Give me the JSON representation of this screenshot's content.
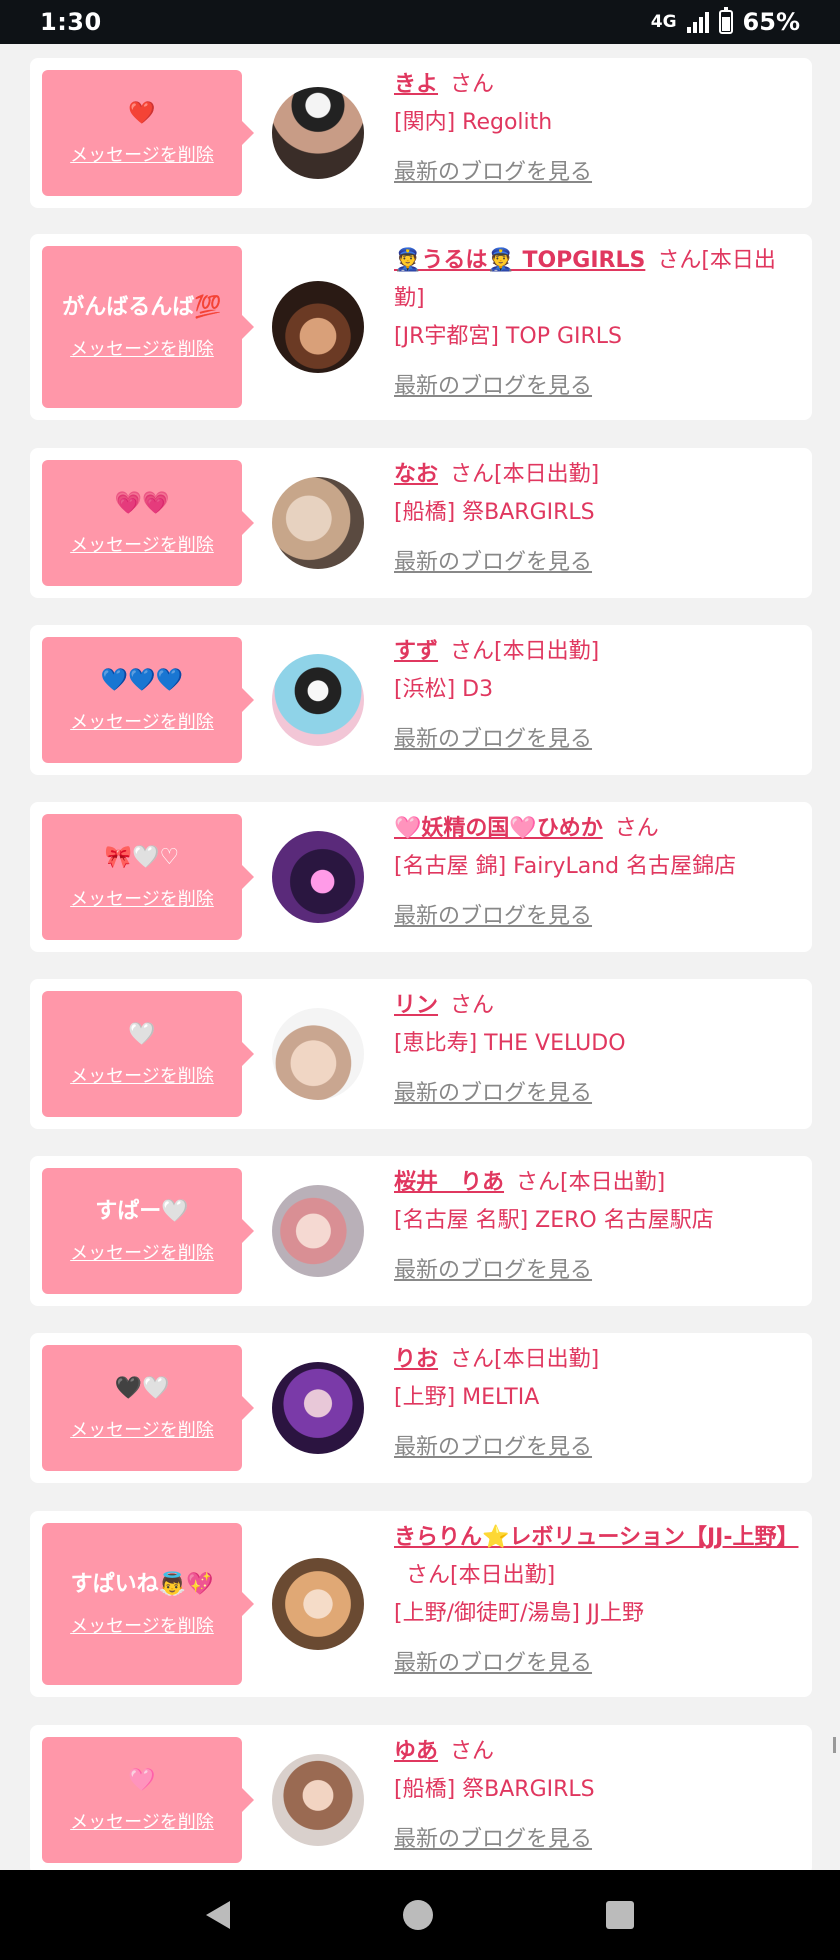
{
  "status_bar": {
    "time": "1:30",
    "network": "4G",
    "battery": "65%"
  },
  "delete_label": "メッセージを削除",
  "blog_label": "最新のブログを見る",
  "san_label": "さん",
  "entries": [
    {
      "message": "❤️",
      "name": "きよ",
      "suffix": "さん",
      "shop": "[関内] Regolith"
    },
    {
      "message": "がんばるんば💯",
      "name": "👮うるは👮 TOPGIRLS",
      "suffix": "さん[本日出勤]",
      "shop": "[JR宇都宮] TOP GIRLS"
    },
    {
      "message": "💗💗",
      "name": "なお",
      "suffix": "さん[本日出勤]",
      "shop": "[船橋] 祭BARGIRLS"
    },
    {
      "message": "💙💙💙",
      "name": "すず",
      "suffix": "さん[本日出勤]",
      "shop": "[浜松] D3"
    },
    {
      "message": "🎀🤍♡",
      "name": "🩷妖精の国🩷ひめか",
      "suffix": "さん",
      "shop": "[名古屋 錦] FairyLand 名古屋錦店"
    },
    {
      "message": "🤍",
      "name": "リン",
      "suffix": "さん",
      "shop": "[恵比寿] THE VELUDO"
    },
    {
      "message": "すぱー🤍",
      "name": "桜井　りあ",
      "suffix": "さん[本日出勤]",
      "shop": "[名古屋 名駅] ZERO 名古屋駅店"
    },
    {
      "message": "🖤🤍",
      "name": "りお",
      "suffix": "さん[本日出勤]",
      "shop": "[上野] MELTIA"
    },
    {
      "message": "すぱいね👼💖",
      "name": "きらりん⭐レボリューション【JJ-上野】",
      "suffix": "さん[本日出勤]",
      "shop": "[上野/御徒町/湯島] JJ上野"
    },
    {
      "message": "🩷",
      "name": "ゆあ",
      "suffix": "さん",
      "shop": "[船橋] 祭BARGIRLS"
    }
  ],
  "colors": {
    "accent": "#e0375f",
    "message_box": "#ff97a9",
    "background": "#f2f2f2"
  }
}
